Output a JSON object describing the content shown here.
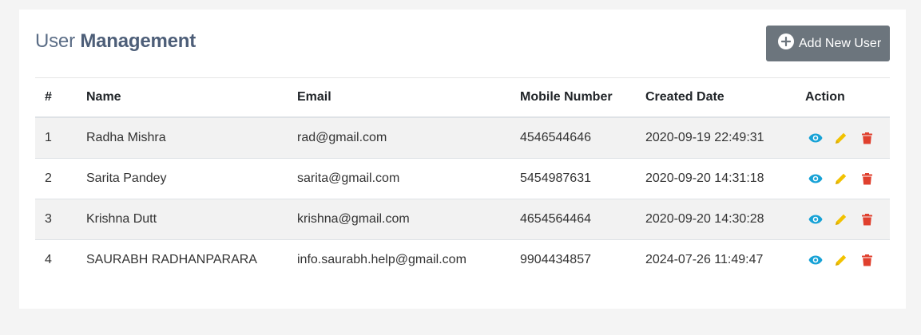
{
  "page": {
    "title_light": "User ",
    "title_bold": "Management",
    "add_button_label": "Add New User"
  },
  "table": {
    "headers": [
      "#",
      "Name",
      "Email",
      "Mobile Number",
      "Created Date",
      "Action"
    ],
    "rows": [
      {
        "num": "1",
        "name": "Radha Mishra",
        "email": "rad@gmail.com",
        "mobile": "4546544646",
        "created": "2020-09-19 22:49:31"
      },
      {
        "num": "2",
        "name": "Sarita Pandey",
        "email": "sarita@gmail.com",
        "mobile": "5454987631",
        "created": "2020-09-20 14:31:18"
      },
      {
        "num": "3",
        "name": "Krishna Dutt",
        "email": "krishna@gmail.com",
        "mobile": "4654564464",
        "created": "2020-09-20 14:30:28"
      },
      {
        "num": "4",
        "name": "SAURABH RADHANPARARA",
        "email": "info.saurabh.help@gmail.com",
        "mobile": "9904434857",
        "created": "2024-07-26 11:49:47"
      }
    ]
  },
  "icons": {
    "view": "eye-icon",
    "edit": "pencil-icon",
    "delete": "trash-icon",
    "add": "plus-circle-icon"
  },
  "colors": {
    "view": "#17a2d6",
    "edit": "#f2c200",
    "delete": "#e0402e",
    "button": "#6c757d"
  }
}
